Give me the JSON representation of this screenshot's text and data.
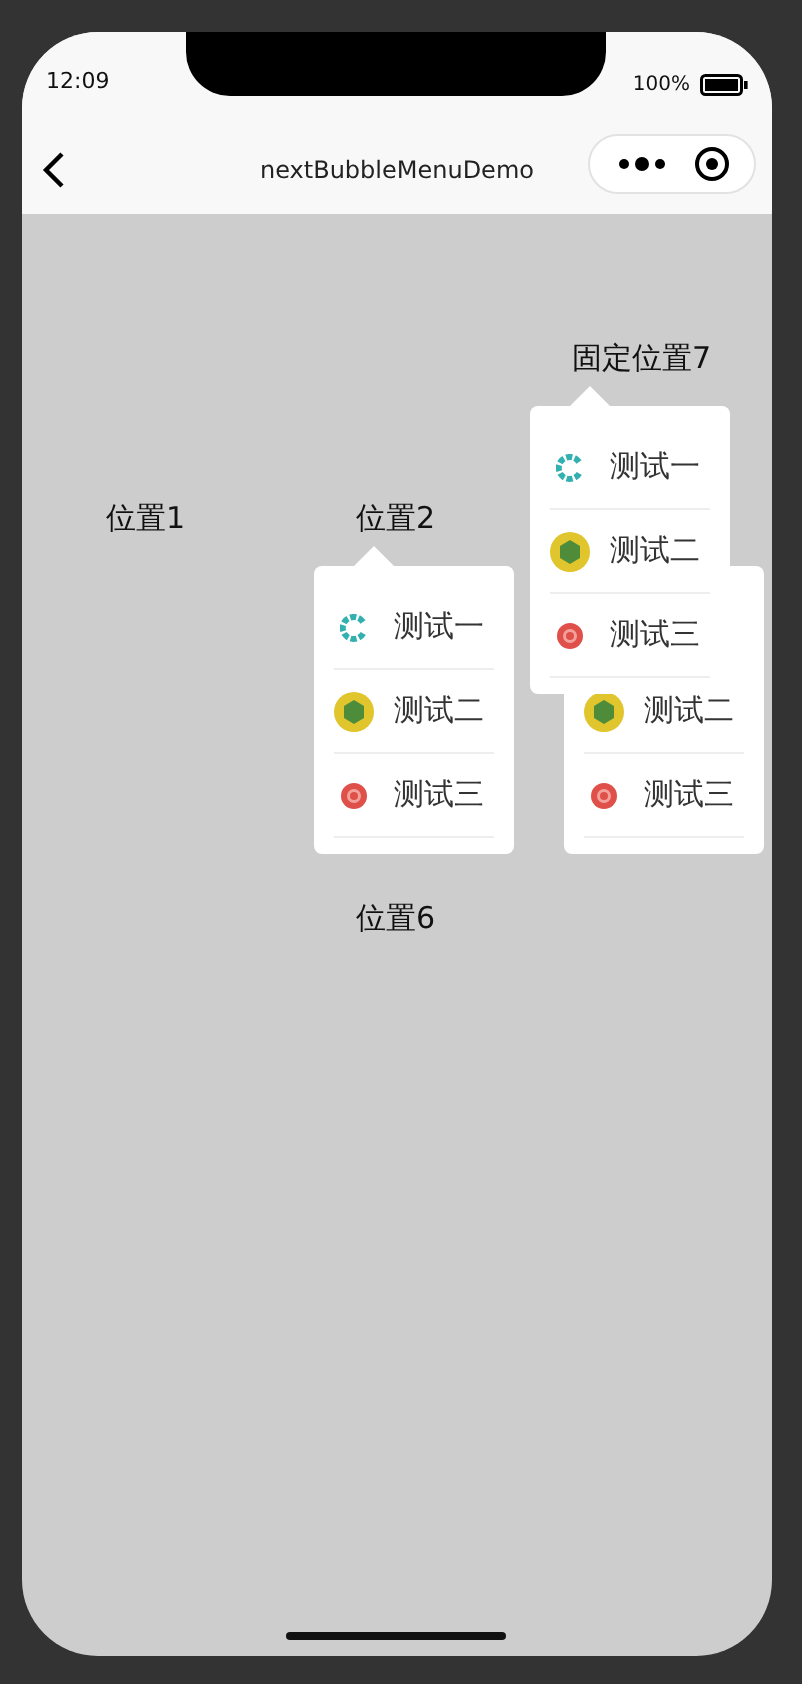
{
  "status_bar": {
    "time": "12:09",
    "battery": "100%"
  },
  "nav_bar": {
    "title": "nextBubbleMenuDemo"
  },
  "labels": [
    {
      "text": "位置1"
    },
    {
      "text": "位置2"
    },
    {
      "text": "位置6"
    },
    {
      "text": "固定位置7"
    }
  ],
  "menus": [
    {
      "items": [
        {
          "kind": "ring",
          "label": "测试一"
        },
        {
          "kind": "hex",
          "label": "测试二"
        },
        {
          "kind": "target",
          "label": "测试三"
        }
      ]
    },
    {
      "items": [
        {
          "kind": "hex",
          "label": "测试二"
        },
        {
          "kind": "target",
          "label": "测试三"
        }
      ]
    },
    {
      "items": [
        {
          "kind": "ring",
          "label": "测试一"
        },
        {
          "kind": "hex",
          "label": "测试二"
        },
        {
          "kind": "target",
          "label": "测试三"
        }
      ]
    }
  ]
}
